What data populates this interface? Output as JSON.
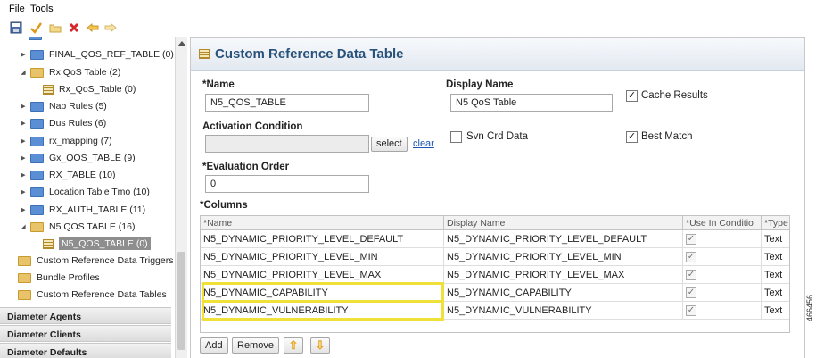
{
  "menu": {
    "file": "File",
    "tools": "Tools"
  },
  "toolbar_icons": [
    "save-icon",
    "check-icon",
    "folder-icon",
    "delete-icon",
    "undo-icon",
    "redo-icon"
  ],
  "tree": {
    "items": [
      {
        "label": "FINAL_QOS_REF_TABLE (0)"
      },
      {
        "label": "Rx QoS Table (2)"
      },
      {
        "label": "Rx_QoS_Table (0)"
      },
      {
        "label": "Nap Rules (5)"
      },
      {
        "label": "Dus Rules (6)"
      },
      {
        "label": "rx_mapping (7)"
      },
      {
        "label": "Gx_QOS_TABLE (9)"
      },
      {
        "label": "RX_TABLE (10)"
      },
      {
        "label": "Location Table Tmo (10)"
      },
      {
        "label": "RX_AUTH_TABLE (11)"
      },
      {
        "label": "N5 QOS TABLE (16)"
      },
      {
        "label": "N5_QOS_TABLE (0)"
      },
      {
        "label": "Custom Reference Data Triggers"
      },
      {
        "label": "Bundle Profiles"
      },
      {
        "label": "Custom Reference Data Tables"
      }
    ],
    "sections": [
      "Diameter Agents",
      "Diameter Clients",
      "Diameter Defaults"
    ]
  },
  "editor": {
    "title": "Custom Reference Data Table",
    "name_label": "*Name",
    "name_value": "N5_QOS_TABLE",
    "display_name_label": "Display Name",
    "display_name_value": "N5 QoS Table",
    "cache_results_label": "Cache Results",
    "activation_label": "Activation Condition",
    "activation_value": "",
    "select_label": "select",
    "clear_label": "clear",
    "svn_crd_label": "Svn Crd Data",
    "best_match_label": "Best Match",
    "eval_order_label": "*Evaluation Order",
    "eval_order_value": "0",
    "columns_label": "*Columns",
    "checkbox_states": {
      "cache_results": true,
      "svn_crd_data": false,
      "best_match": true
    }
  },
  "columns_table": {
    "headers": [
      "*Name",
      "Display Name",
      "*Use In Conditio",
      "*Type"
    ],
    "rows": [
      {
        "name": "N5_DYNAMIC_PRIORITY_LEVEL_DEFAULT",
        "display": "N5_DYNAMIC_PRIORITY_LEVEL_DEFAULT",
        "use": true,
        "type": "Text"
      },
      {
        "name": "N5_DYNAMIC_PRIORITY_LEVEL_MIN",
        "display": "N5_DYNAMIC_PRIORITY_LEVEL_MIN",
        "use": true,
        "type": "Text"
      },
      {
        "name": "N5_DYNAMIC_PRIORITY_LEVEL_MAX",
        "display": "N5_DYNAMIC_PRIORITY_LEVEL_MAX",
        "use": true,
        "type": "Text"
      },
      {
        "name": "N5_DYNAMIC_CAPABILITY",
        "display": "N5_DYNAMIC_CAPABILITY",
        "use": true,
        "type": "Text"
      },
      {
        "name": "N5_DYNAMIC_VULNERABILITY",
        "display": "N5_DYNAMIC_VULNERABILITY",
        "use": true,
        "type": "Text"
      }
    ],
    "highlight_color": "#f0e03a"
  },
  "buttons": {
    "add": "Add",
    "remove": "Remove"
  },
  "figure_id": "466456",
  "colors": {
    "title": "#29527a",
    "link": "#1a55b0",
    "selected_bg": "#8e8e8e"
  }
}
